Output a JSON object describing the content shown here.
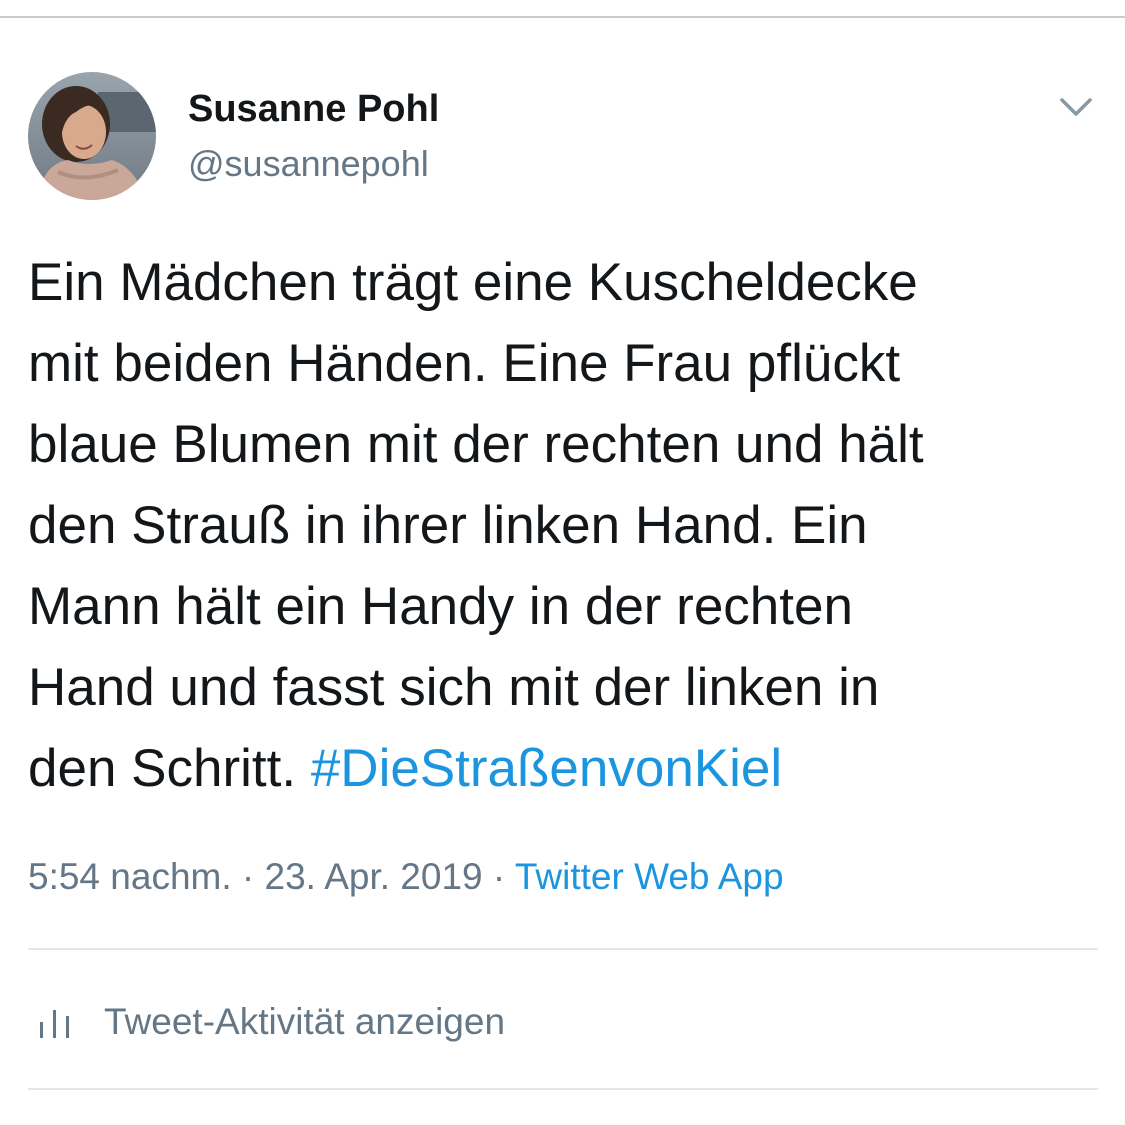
{
  "tweet": {
    "author": {
      "display_name": "Susanne Pohl",
      "handle": "@susannepohl",
      "avatar": "avatar-photo"
    },
    "text_lines": [
      "Ein Mädchen trägt eine Kuscheldecke",
      "mit beiden Händen. Eine Frau pflückt",
      "blaue Blumen mit der rechten und hält",
      "den Strauß in ihrer linken Hand. Ein",
      "Mann hält ein Handy in der rechten",
      "Hand und fasst sich mit der linken in",
      "den Schritt. "
    ],
    "hashtag": "#DieStraßenvonKiel",
    "time": "5:54 nachm.",
    "separator": " · ",
    "date": "23. Apr. 2019",
    "source": "Twitter Web App",
    "activity_label": "Tweet-Aktivität anzeigen"
  },
  "icons": {
    "menu": "chevron-down-icon",
    "activity": "bar-chart-icon"
  },
  "colors": {
    "text": "#14171a",
    "secondary": "#657786",
    "link": "#1b95e0",
    "divider": "#e1e8ed"
  }
}
